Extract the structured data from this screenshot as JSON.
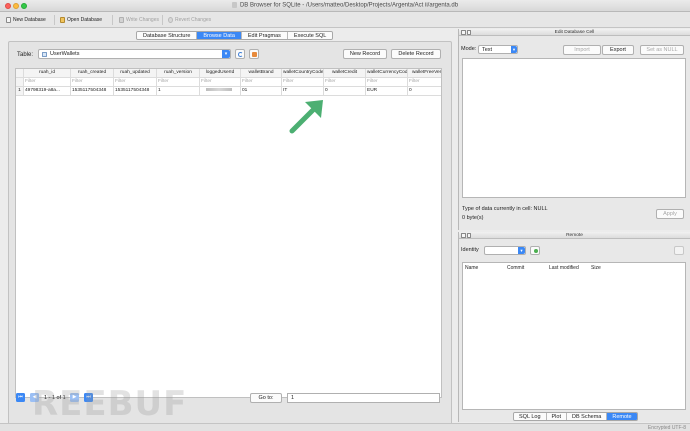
{
  "window": {
    "title": "DB Browser for SQLite - /Users/matteo/Desktop/Projects/Argenta/Act ii/argenta.db"
  },
  "toolbar": {
    "new_database": "New Database",
    "open_database": "Open Database",
    "write_changes": "Write Changes",
    "revert_changes": "Revert Changes"
  },
  "tabs": [
    "Database Structure",
    "Browse Data",
    "Edit Pragmas",
    "Execute SQL"
  ],
  "browse": {
    "table_label": "Table:",
    "table_value": "UserWallets",
    "new_record": "New Record",
    "delete_record": "Delete Record",
    "columns": [
      "ruah_id",
      "ruah_created",
      "ruah_updated",
      "ruah_version",
      "loggedUserId",
      "walletBrand",
      "walletCountryCode",
      "walletCredit",
      "walletCurrencyCode",
      "walletFreeVend"
    ],
    "filter_placeholder": "Filter",
    "rows": [
      {
        "rownum": "1",
        "cells": [
          "49798319-a8a...",
          "1535117504348",
          "1535117504348",
          "1",
          "",
          "01",
          "IT",
          "0",
          "EUR",
          "0"
        ]
      }
    ]
  },
  "pager": {
    "first": "⏮",
    "prev": "◀",
    "status": "1 - 1 of 1",
    "next": "▶",
    "last": "⏭",
    "goto_label": "Go to:",
    "goto_value": "1"
  },
  "watermark": "REEBUF",
  "edit_cell": {
    "title": "Edit Database Cell",
    "mode_label": "Mode:",
    "mode_value": "Text",
    "import": "Import",
    "export": "Export",
    "set_null": "Set as NULL",
    "type_info": "Type of data currently in cell: NULL",
    "size_info": "0 byte(s)",
    "apply": "Apply"
  },
  "remote": {
    "title": "Remote",
    "identity_label": "Identity",
    "headers": [
      "Name",
      "Commit",
      "Last modified",
      "Size"
    ]
  },
  "bottom_tabs": [
    "SQL Log",
    "Plot",
    "DB Schema",
    "Remote"
  ],
  "status": {
    "encoding": "Encrypted  UTF-8"
  },
  "colors": {
    "accent": "#3b88f5",
    "arrow": "#4caf72"
  }
}
